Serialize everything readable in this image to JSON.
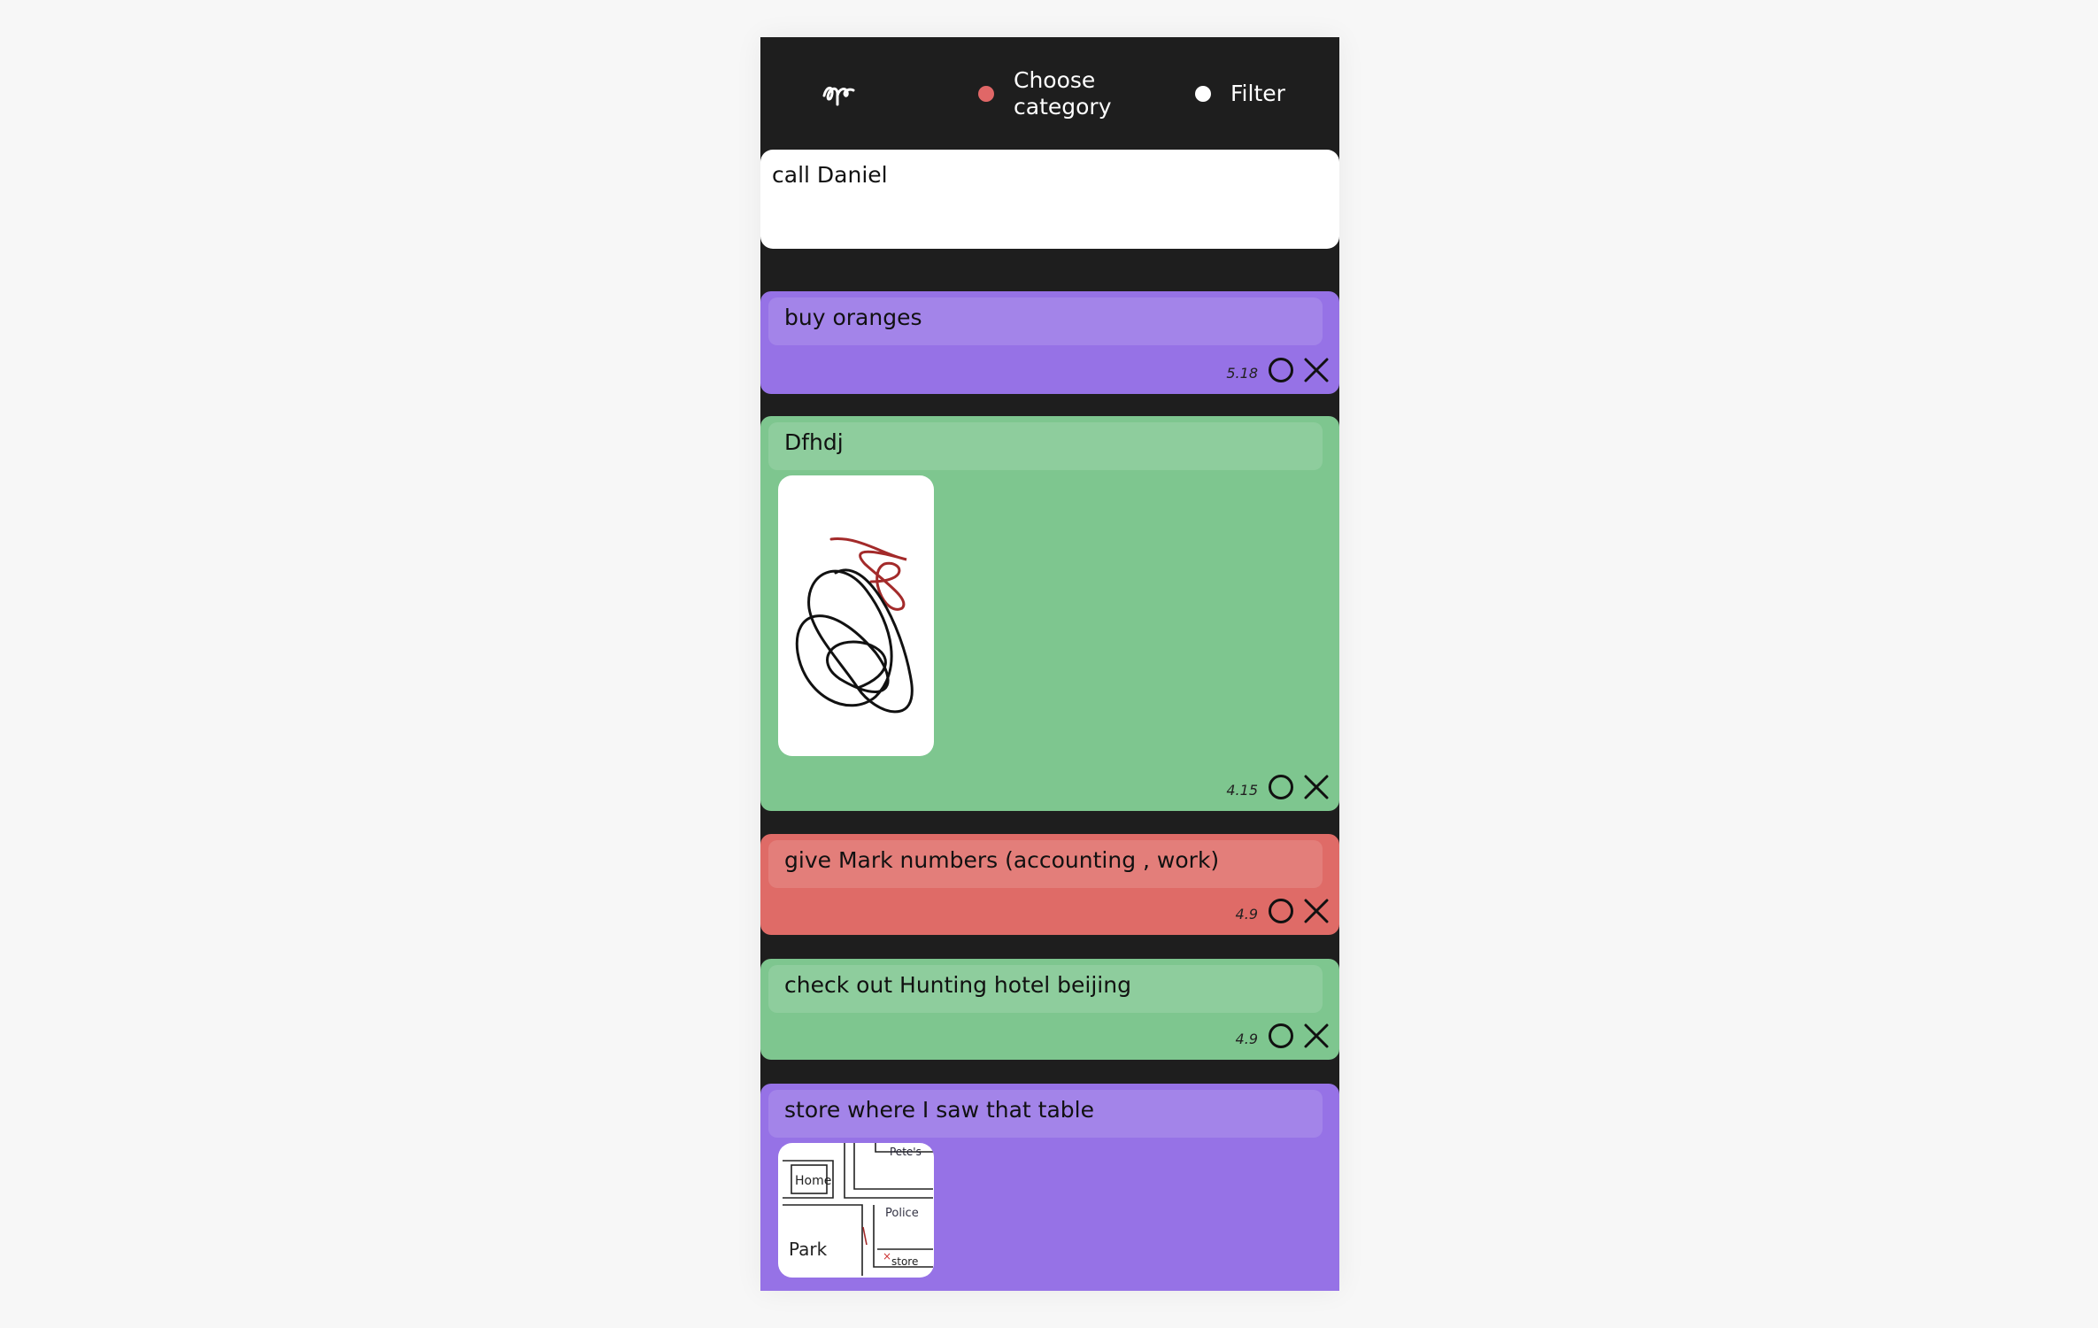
{
  "header": {
    "logo_icon": "scribble-logo-icon",
    "category_label": "Choose category",
    "category_dot_color": "#e06767",
    "filter_label": "Filter",
    "filter_dot_color": "#ffffff"
  },
  "new_note": {
    "value": "call Daniel"
  },
  "notes": [
    {
      "title": "buy oranges",
      "date": "5.18",
      "color": "#9672e6"
    },
    {
      "title": "Dfhdj",
      "date": "4.15",
      "color": "#7ec68f",
      "attachment": "scribble-drawing"
    },
    {
      "title": "give Mark numbers (accounting , work)",
      "date": "4.9",
      "color": "#df6b67"
    },
    {
      "title": "check out Hunting hotel beijing",
      "date": "4.9",
      "color": "#7ec68f"
    },
    {
      "title": "store where I saw that table",
      "color": "#9672e6",
      "attachment": "map-sketch",
      "map_labels": {
        "home": "Home",
        "petes": "Pete's",
        "police": "Police",
        "park": "Park",
        "store": "store"
      }
    }
  ],
  "icons": {
    "complete": "circle-complete-icon",
    "delete": "close-icon"
  }
}
